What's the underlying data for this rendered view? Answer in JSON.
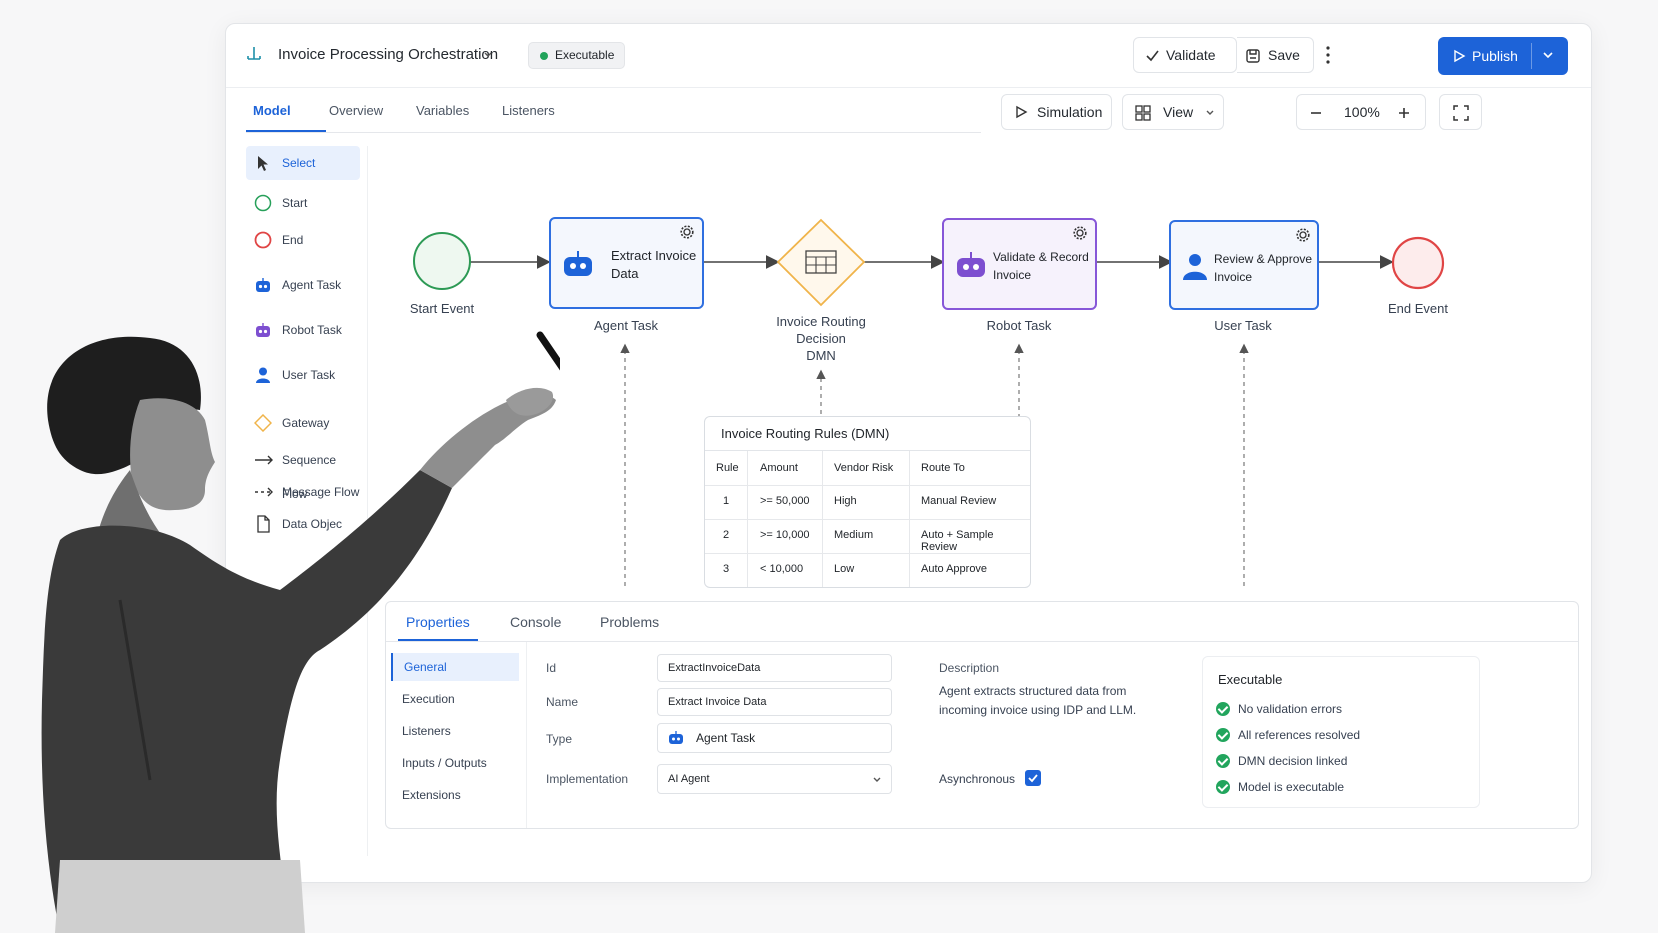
{
  "header": {
    "title": "Invoice Processing Orchestration",
    "status_badge": "Executable",
    "validate_label": "Validate",
    "save_label": "Save",
    "publish_label": "Publish"
  },
  "tabs": [
    "Model",
    "Overview",
    "Variables",
    "Listeners"
  ],
  "toolbar": {
    "simulation_label": "Simulation",
    "view_label": "View",
    "zoom": "100%"
  },
  "palette": [
    "Select",
    "Start",
    "End",
    "Agent Task",
    "Robot Task",
    "User Task",
    "Gateway",
    "Sequence Flow",
    "Message Flow",
    "Data Objec"
  ],
  "diagram": {
    "start_event": "Start Event",
    "agent_task": {
      "name": "Extract Invoice Data",
      "type": "Agent Task"
    },
    "gateway": {
      "name": "Invoice Routing Decision",
      "type": "DMN"
    },
    "robot_task": {
      "name": "Validate & Record Invoice",
      "type": "Robot Task"
    },
    "user_task": {
      "name": "Review & Approve Invoice",
      "type": "User Task"
    },
    "end_event": "End Event"
  },
  "dmn_table": {
    "title": "Invoice Routing Rules (DMN)",
    "columns": [
      "Rule",
      "Amount",
      "Vendor Risk",
      "Route To"
    ],
    "rows": [
      [
        "1",
        ">= 50,000",
        "High",
        "Manual Review"
      ],
      [
        "2",
        ">= 10,000",
        "Medium",
        "Auto + Sample Review"
      ],
      [
        "3",
        "< 10,000",
        "Low",
        "Auto Approve"
      ]
    ]
  },
  "panel": {
    "tabs": [
      "Properties",
      "Console",
      "Problems"
    ],
    "sections": [
      "General",
      "Execution",
      "Listeners",
      "Inputs / Outputs",
      "Extensions"
    ],
    "fields": {
      "id_label": "Id",
      "id_value": "ExtractInvoiceData",
      "name_label": "Name",
      "name_value": "Extract Invoice Data",
      "type_label": "Type",
      "type_value": "Agent Task",
      "impl_label": "Implementation",
      "impl_value": "AI Agent"
    },
    "description_label": "Description",
    "description_text": "Agent extracts structured data from incoming invoice using IDP and LLM.",
    "async_label": "Asynchronous",
    "async_checked": true,
    "summary_title": "Executable",
    "checks": [
      "No validation errors",
      "All references resolved",
      "DMN decision linked",
      "Model is executable"
    ]
  },
  "colors": {
    "accent": "#1d63d8",
    "success": "#22a55d",
    "gateway": "#f0b44a",
    "robot": "#7d4fd0",
    "end": "#e54848"
  }
}
